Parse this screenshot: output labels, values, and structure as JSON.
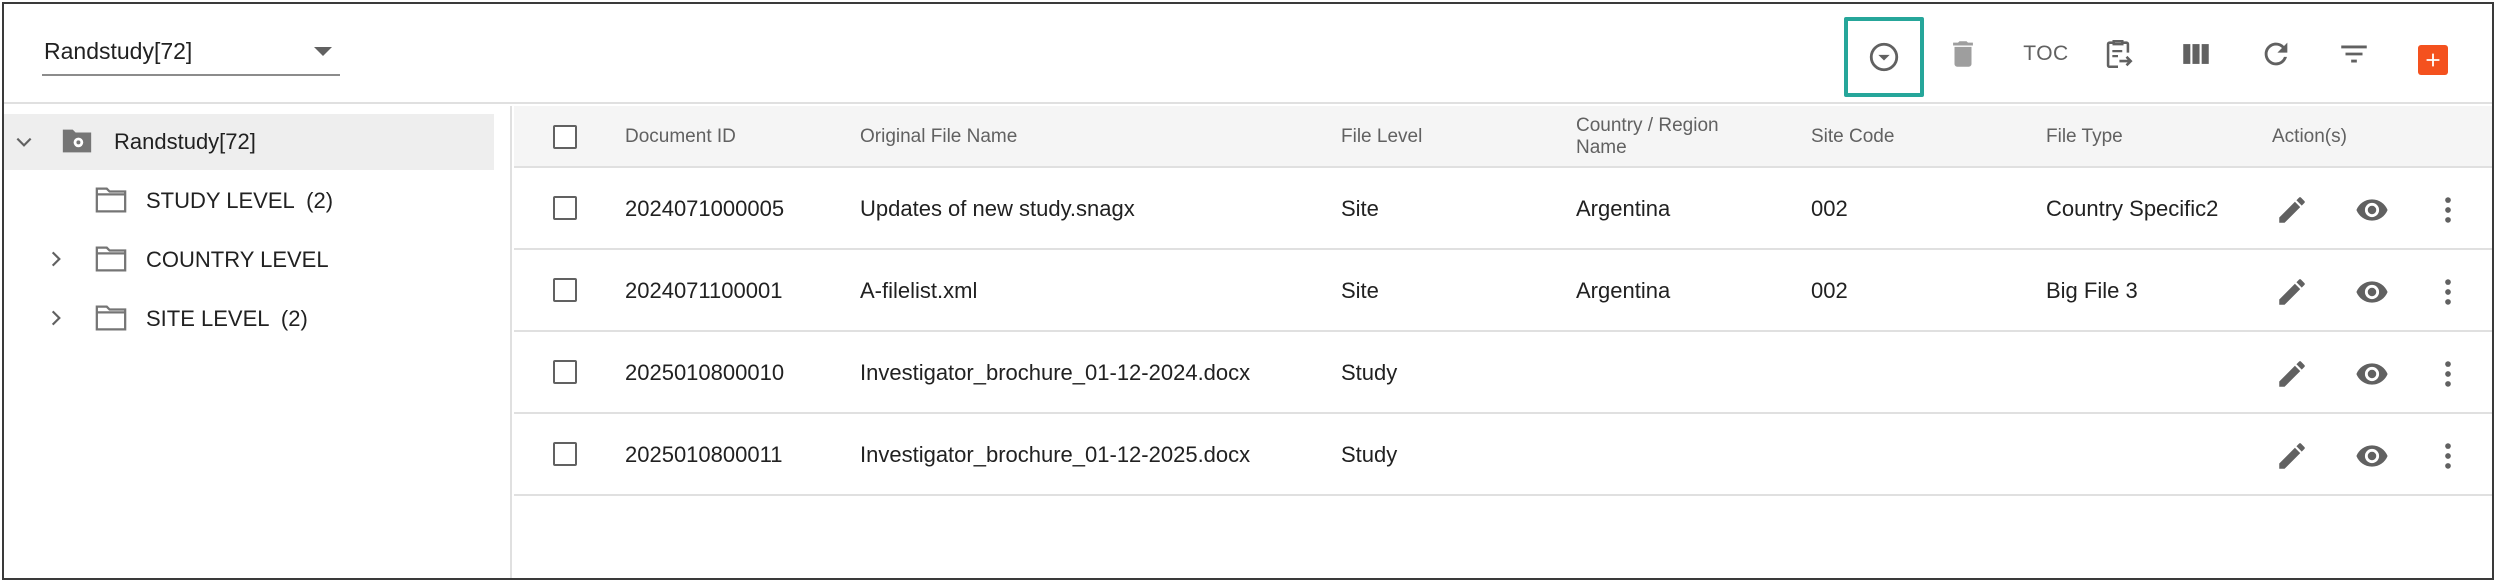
{
  "toolbar": {
    "study_select_value": "Randstudy[72]",
    "icons": [
      "chevron-circle-down-icon",
      "trash-icon",
      "toc-text",
      "clipboard-move-icon",
      "columns-icon",
      "refresh-icon",
      "filter-icon",
      "add-icon"
    ],
    "toc_label": "TOC"
  },
  "colors": {
    "highlight_border": "#26a69a",
    "add_button": "#f4511e",
    "header_bg": "#f5f5f5",
    "tree_selected_bg": "#eeeeee"
  },
  "tree": {
    "root": {
      "label": "Randstudy[72]",
      "expanded": true
    },
    "children": [
      {
        "label": "STUDY LEVEL  (2)",
        "has_children": false
      },
      {
        "label": "COUNTRY LEVEL",
        "has_children": true
      },
      {
        "label": "SITE LEVEL  (2)",
        "has_children": true
      }
    ]
  },
  "grid": {
    "headers": {
      "document_id": "Document ID",
      "original_file_name": "Original File Name",
      "file_level": "File Level",
      "country_region_line1": "Country / Region",
      "country_region_line2": "Name",
      "site_code": "Site Code",
      "file_type": "File Type",
      "actions": "Action(s)"
    },
    "rows": [
      {
        "document_id": "2024071000005",
        "original_file_name": "Updates of new study.snagx",
        "file_level": "Site",
        "country": "Argentina",
        "site_code": "002",
        "file_type": "Country Specific2"
      },
      {
        "document_id": "2024071100001",
        "original_file_name": "A-filelist.xml",
        "file_level": "Site",
        "country": "Argentina",
        "site_code": "002",
        "file_type": "Big File 3"
      },
      {
        "document_id": "2025010800010",
        "original_file_name": "Investigator_brochure_01-12-2024.docx",
        "file_level": "Study",
        "country": "",
        "site_code": "",
        "file_type": ""
      },
      {
        "document_id": "2025010800011",
        "original_file_name": "Investigator_brochure_01-12-2025.docx",
        "file_level": "Study",
        "country": "",
        "site_code": "",
        "file_type": ""
      }
    ]
  }
}
